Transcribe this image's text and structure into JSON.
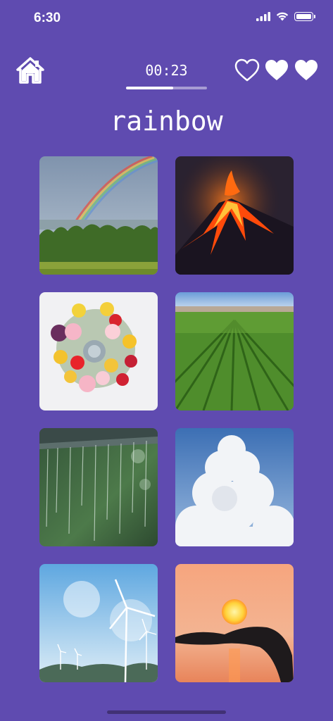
{
  "status": {
    "time": "6:30",
    "icons": [
      "signal-icon",
      "wifi-icon",
      "battery-icon"
    ]
  },
  "header": {
    "home_icon": "home-icon",
    "timer": "00:23",
    "timer_progress": 0.58,
    "lives": [
      {
        "icon": "heart-icon",
        "state": "empty"
      },
      {
        "icon": "heart-icon",
        "state": "full"
      },
      {
        "icon": "heart-icon",
        "state": "full"
      }
    ]
  },
  "prompt_word": "rainbow",
  "tiles": [
    {
      "subject": "rainbow over forest"
    },
    {
      "subject": "erupting volcano"
    },
    {
      "subject": "flower bouquet"
    },
    {
      "subject": "green crop field"
    },
    {
      "subject": "rain"
    },
    {
      "subject": "cumulus cloud"
    },
    {
      "subject": "wind turbines"
    },
    {
      "subject": "sunset in hand"
    }
  ],
  "colors": {
    "background": "#5f4bb0",
    "text": "#ffffff"
  }
}
